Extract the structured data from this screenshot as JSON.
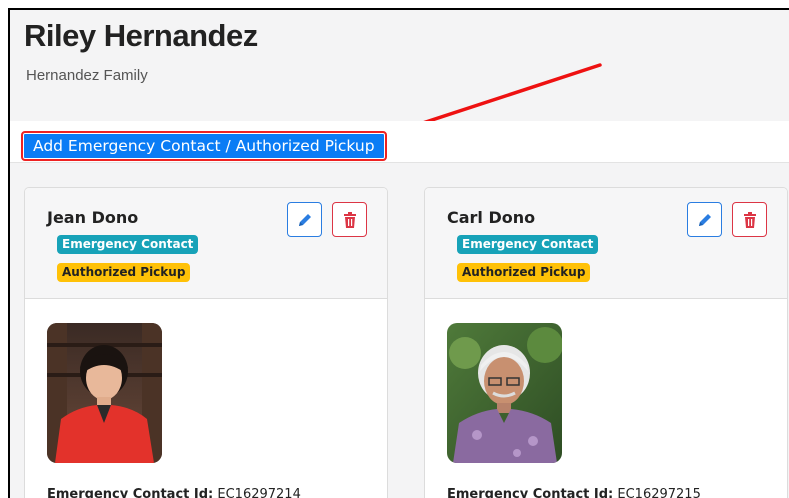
{
  "header": {
    "title": "Riley Hernandez",
    "subtitle": "Hernandez Family"
  },
  "toolbar": {
    "add_label": "Add Emergency Contact / Authorized Pickup"
  },
  "contacts": [
    {
      "name": "Jean Dono",
      "badges": [
        "Emergency Contact",
        "Authorized Pickup"
      ],
      "id_label": "Emergency Contact Id:",
      "id_value": "EC16297214",
      "edit_icon": "pencil-icon",
      "delete_icon": "trash-icon"
    },
    {
      "name": "Carl Dono",
      "badges": [
        "Emergency Contact",
        "Authorized Pickup"
      ],
      "id_label": "Emergency Contact Id:",
      "id_value": "EC16297215",
      "edit_icon": "pencil-icon",
      "delete_icon": "trash-icon"
    }
  ],
  "colors": {
    "primary": "#0a7cf5",
    "highlight": "#e22222",
    "info_badge": "#17a2b8",
    "warning_badge": "#ffc107",
    "danger": "#dc3545"
  }
}
